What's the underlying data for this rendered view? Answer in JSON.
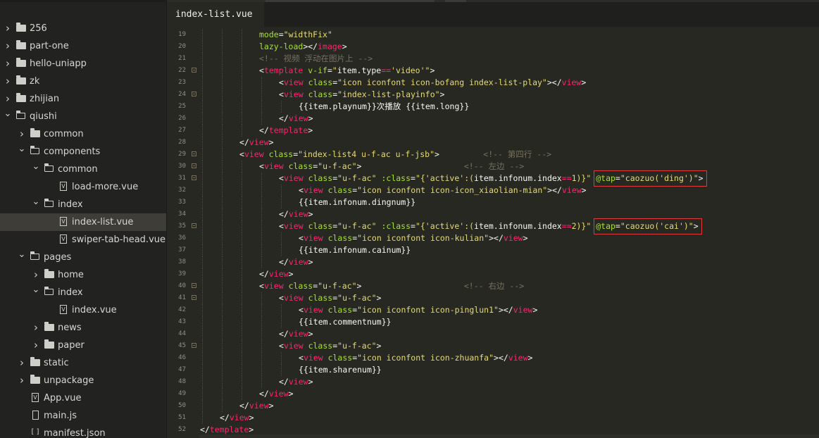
{
  "tab": {
    "title": "index-list.vue"
  },
  "tree": [
    {
      "name": "256",
      "type": "folder",
      "depth": 0,
      "expanded": false
    },
    {
      "name": "part-one",
      "type": "folder",
      "depth": 0,
      "expanded": false
    },
    {
      "name": "hello-uniapp",
      "type": "folder",
      "depth": 0,
      "expanded": false
    },
    {
      "name": "zk",
      "type": "folder",
      "depth": 0,
      "expanded": false
    },
    {
      "name": "zhijian",
      "type": "folder",
      "depth": 0,
      "expanded": false
    },
    {
      "name": "qiushi",
      "type": "folder",
      "depth": 0,
      "expanded": true
    },
    {
      "name": "common",
      "type": "folder",
      "depth": 1,
      "expanded": false
    },
    {
      "name": "components",
      "type": "folder",
      "depth": 1,
      "expanded": true
    },
    {
      "name": "common",
      "type": "folder",
      "depth": 2,
      "expanded": true
    },
    {
      "name": "load-more.vue",
      "type": "vue",
      "depth": 3
    },
    {
      "name": "index",
      "type": "folder",
      "depth": 2,
      "expanded": true
    },
    {
      "name": "index-list.vue",
      "type": "vue",
      "depth": 3,
      "selected": true
    },
    {
      "name": "swiper-tab-head.vue",
      "type": "vue",
      "depth": 3
    },
    {
      "name": "pages",
      "type": "folder",
      "depth": 1,
      "expanded": true
    },
    {
      "name": "home",
      "type": "folder",
      "depth": 2,
      "expanded": false
    },
    {
      "name": "index",
      "type": "folder",
      "depth": 2,
      "expanded": true
    },
    {
      "name": "index.vue",
      "type": "vue",
      "depth": 3
    },
    {
      "name": "news",
      "type": "folder",
      "depth": 2,
      "expanded": false
    },
    {
      "name": "paper",
      "type": "folder",
      "depth": 2,
      "expanded": false
    },
    {
      "name": "static",
      "type": "folder",
      "depth": 1,
      "expanded": false
    },
    {
      "name": "unpackage",
      "type": "folder",
      "depth": 1,
      "expanded": false
    },
    {
      "name": "App.vue",
      "type": "vue",
      "depth": 1
    },
    {
      "name": "main.js",
      "type": "js",
      "depth": 1
    },
    {
      "name": "manifest.json",
      "type": "json",
      "depth": 1
    }
  ],
  "code": [
    {
      "n": "19",
      "indent": 3,
      "fold": false,
      "tokens": [
        [
          "attr",
          "mode"
        ],
        [
          "pun",
          "="
        ],
        [
          "str",
          "\"widthFix\""
        ]
      ]
    },
    {
      "n": "20",
      "indent": 3,
      "fold": false,
      "tokens": [
        [
          "attr",
          "lazy-load"
        ],
        [
          "pun",
          ">"
        ],
        [
          "pun",
          "</"
        ],
        [
          "tag",
          "image"
        ],
        [
          "pun",
          ">"
        ]
      ]
    },
    {
      "n": "21",
      "indent": 3,
      "fold": false,
      "tokens": [
        [
          "com",
          "<!-- 视频 浮动在图片上 -->"
        ]
      ]
    },
    {
      "n": "22",
      "indent": 3,
      "fold": true,
      "tokens": [
        [
          "pun",
          "<"
        ],
        [
          "tag",
          "template"
        ],
        [
          "pun",
          " "
        ],
        [
          "attr",
          "v-if"
        ],
        [
          "pun",
          "="
        ],
        [
          "str",
          "\""
        ],
        [
          "expr",
          "item"
        ],
        [
          "pun",
          "."
        ],
        [
          "expr",
          "type"
        ],
        [
          "op",
          "=="
        ],
        [
          "str",
          "'video'\""
        ],
        [
          "pun",
          ">"
        ]
      ]
    },
    {
      "n": "23",
      "indent": 4,
      "fold": false,
      "tokens": [
        [
          "pun",
          "<"
        ],
        [
          "tag",
          "view"
        ],
        [
          "pun",
          " "
        ],
        [
          "attr",
          "class"
        ],
        [
          "pun",
          "="
        ],
        [
          "str",
          "\"icon iconfont icon-bofang index-list-play\""
        ],
        [
          "pun",
          ">"
        ],
        [
          "pun",
          "</"
        ],
        [
          "tag",
          "view"
        ],
        [
          "pun",
          ">"
        ]
      ]
    },
    {
      "n": "24",
      "indent": 4,
      "fold": true,
      "tokens": [
        [
          "pun",
          "<"
        ],
        [
          "tag",
          "view"
        ],
        [
          "pun",
          " "
        ],
        [
          "attr",
          "class"
        ],
        [
          "pun",
          "="
        ],
        [
          "str",
          "\"index-list-playinfo\""
        ],
        [
          "pun",
          ">"
        ]
      ]
    },
    {
      "n": "25",
      "indent": 5,
      "fold": false,
      "tokens": [
        [
          "expr",
          "{{item"
        ],
        [
          "pun",
          "."
        ],
        [
          "expr",
          "playnum}}次播放 {{item"
        ],
        [
          "pun",
          "."
        ],
        [
          "expr",
          "long}}"
        ]
      ]
    },
    {
      "n": "26",
      "indent": 4,
      "fold": false,
      "tokens": [
        [
          "pun",
          "</"
        ],
        [
          "tag",
          "view"
        ],
        [
          "pun",
          ">"
        ]
      ]
    },
    {
      "n": "27",
      "indent": 3,
      "fold": false,
      "tokens": [
        [
          "pun",
          "</"
        ],
        [
          "tag",
          "template"
        ],
        [
          "pun",
          ">"
        ]
      ]
    },
    {
      "n": "28",
      "indent": 2,
      "fold": false,
      "tokens": [
        [
          "pun",
          "</"
        ],
        [
          "tag",
          "view"
        ],
        [
          "pun",
          ">"
        ]
      ]
    },
    {
      "n": "29",
      "indent": 2,
      "fold": true,
      "tokens": [
        [
          "pun",
          "<"
        ],
        [
          "tag",
          "view"
        ],
        [
          "pun",
          " "
        ],
        [
          "attr",
          "class"
        ],
        [
          "pun",
          "="
        ],
        [
          "str",
          "\"index-list4 u-f-ac u-f-jsb\""
        ],
        [
          "pun",
          ">"
        ],
        [
          "pun",
          "         "
        ],
        [
          "com",
          "<!-- 第四行 -->"
        ]
      ]
    },
    {
      "n": "30",
      "indent": 3,
      "fold": true,
      "tokens": [
        [
          "pun",
          "<"
        ],
        [
          "tag",
          "view"
        ],
        [
          "pun",
          " "
        ],
        [
          "attr",
          "class"
        ],
        [
          "pun",
          "="
        ],
        [
          "str",
          "\"u-f-ac\""
        ],
        [
          "pun",
          ">"
        ],
        [
          "pun",
          "                     "
        ],
        [
          "com",
          "<!-- 左边 -->"
        ]
      ]
    },
    {
      "n": "31",
      "indent": 4,
      "fold": true,
      "tokens": [
        [
          "pun",
          "<"
        ],
        [
          "tag",
          "view"
        ],
        [
          "pun",
          " "
        ],
        [
          "attr",
          "class"
        ],
        [
          "pun",
          "="
        ],
        [
          "str",
          "\"u-f-ac\""
        ],
        [
          "pun",
          " "
        ],
        [
          "attr",
          ":class"
        ],
        [
          "pun",
          "="
        ],
        [
          "str",
          "\"{'active':("
        ],
        [
          "expr",
          "item"
        ],
        [
          "pun",
          "."
        ],
        [
          "expr",
          "infonum"
        ],
        [
          "pun",
          "."
        ],
        [
          "expr",
          "index"
        ],
        [
          "op",
          "=="
        ],
        [
          "str",
          "1)}\""
        ],
        [
          "pun",
          " "
        ],
        [
          "attr",
          "@tap"
        ],
        [
          "pun",
          "="
        ],
        [
          "str",
          "\"caozuo('ding')\""
        ],
        [
          "pun",
          ">"
        ]
      ]
    },
    {
      "n": "32",
      "indent": 5,
      "fold": false,
      "tokens": [
        [
          "pun",
          "<"
        ],
        [
          "tag",
          "view"
        ],
        [
          "pun",
          " "
        ],
        [
          "attr",
          "class"
        ],
        [
          "pun",
          "="
        ],
        [
          "str",
          "\"icon iconfont icon-icon_xiaolian-mian\""
        ],
        [
          "pun",
          ">"
        ],
        [
          "pun",
          "</"
        ],
        [
          "tag",
          "view"
        ],
        [
          "pun",
          ">"
        ]
      ]
    },
    {
      "n": "33",
      "indent": 5,
      "fold": false,
      "tokens": [
        [
          "expr",
          "{{item"
        ],
        [
          "pun",
          "."
        ],
        [
          "expr",
          "infonum"
        ],
        [
          "pun",
          "."
        ],
        [
          "expr",
          "dingnum}}"
        ]
      ]
    },
    {
      "n": "34",
      "indent": 4,
      "fold": false,
      "tokens": [
        [
          "pun",
          "</"
        ],
        [
          "tag",
          "view"
        ],
        [
          "pun",
          ">"
        ]
      ]
    },
    {
      "n": "35",
      "indent": 4,
      "fold": true,
      "tokens": [
        [
          "pun",
          "<"
        ],
        [
          "tag",
          "view"
        ],
        [
          "pun",
          " "
        ],
        [
          "attr",
          "class"
        ],
        [
          "pun",
          "="
        ],
        [
          "str",
          "\"u-f-ac\""
        ],
        [
          "pun",
          " "
        ],
        [
          "attr",
          ":class"
        ],
        [
          "pun",
          "="
        ],
        [
          "str",
          "\"{'active':("
        ],
        [
          "expr",
          "item"
        ],
        [
          "pun",
          "."
        ],
        [
          "expr",
          "infonum"
        ],
        [
          "pun",
          "."
        ],
        [
          "expr",
          "index"
        ],
        [
          "op",
          "=="
        ],
        [
          "str",
          "2)}\""
        ],
        [
          "pun",
          " "
        ],
        [
          "attr",
          "@tap"
        ],
        [
          "pun",
          "="
        ],
        [
          "str",
          "\"caozuo('cai')\""
        ],
        [
          "pun",
          ">"
        ]
      ]
    },
    {
      "n": "36",
      "indent": 5,
      "fold": false,
      "tokens": [
        [
          "pun",
          "<"
        ],
        [
          "tag",
          "view"
        ],
        [
          "pun",
          " "
        ],
        [
          "attr",
          "class"
        ],
        [
          "pun",
          "="
        ],
        [
          "str",
          "\"icon iconfont icon-kulian\""
        ],
        [
          "pun",
          ">"
        ],
        [
          "pun",
          "</"
        ],
        [
          "tag",
          "view"
        ],
        [
          "pun",
          ">"
        ]
      ]
    },
    {
      "n": "37",
      "indent": 5,
      "fold": false,
      "tokens": [
        [
          "expr",
          "{{item"
        ],
        [
          "pun",
          "."
        ],
        [
          "expr",
          "infonum"
        ],
        [
          "pun",
          "."
        ],
        [
          "expr",
          "cainum}}"
        ]
      ]
    },
    {
      "n": "38",
      "indent": 4,
      "fold": false,
      "tokens": [
        [
          "pun",
          "</"
        ],
        [
          "tag",
          "view"
        ],
        [
          "pun",
          ">"
        ]
      ]
    },
    {
      "n": "39",
      "indent": 3,
      "fold": false,
      "tokens": [
        [
          "pun",
          "</"
        ],
        [
          "tag",
          "view"
        ],
        [
          "pun",
          ">"
        ]
      ]
    },
    {
      "n": "40",
      "indent": 3,
      "fold": true,
      "tokens": [
        [
          "pun",
          "<"
        ],
        [
          "tag",
          "view"
        ],
        [
          "pun",
          " "
        ],
        [
          "attr",
          "class"
        ],
        [
          "pun",
          "="
        ],
        [
          "str",
          "\"u-f-ac\""
        ],
        [
          "pun",
          ">"
        ],
        [
          "pun",
          "                     "
        ],
        [
          "com",
          "<!-- 右边 -->"
        ]
      ]
    },
    {
      "n": "41",
      "indent": 4,
      "fold": true,
      "tokens": [
        [
          "pun",
          "<"
        ],
        [
          "tag",
          "view"
        ],
        [
          "pun",
          " "
        ],
        [
          "attr",
          "class"
        ],
        [
          "pun",
          "="
        ],
        [
          "str",
          "\"u-f-ac\""
        ],
        [
          "pun",
          ">"
        ]
      ]
    },
    {
      "n": "42",
      "indent": 5,
      "fold": false,
      "tokens": [
        [
          "pun",
          "<"
        ],
        [
          "tag",
          "view"
        ],
        [
          "pun",
          " "
        ],
        [
          "attr",
          "class"
        ],
        [
          "pun",
          "="
        ],
        [
          "str",
          "\"icon iconfont icon-pinglun1\""
        ],
        [
          "pun",
          ">"
        ],
        [
          "pun",
          "</"
        ],
        [
          "tag",
          "view"
        ],
        [
          "pun",
          ">"
        ]
      ]
    },
    {
      "n": "43",
      "indent": 5,
      "fold": false,
      "tokens": [
        [
          "expr",
          "{{item"
        ],
        [
          "pun",
          "."
        ],
        [
          "expr",
          "commentnum}}"
        ]
      ]
    },
    {
      "n": "44",
      "indent": 4,
      "fold": false,
      "tokens": [
        [
          "pun",
          "</"
        ],
        [
          "tag",
          "view"
        ],
        [
          "pun",
          ">"
        ]
      ]
    },
    {
      "n": "45",
      "indent": 4,
      "fold": true,
      "tokens": [
        [
          "pun",
          "<"
        ],
        [
          "tag",
          "view"
        ],
        [
          "pun",
          " "
        ],
        [
          "attr",
          "class"
        ],
        [
          "pun",
          "="
        ],
        [
          "str",
          "\"u-f-ac\""
        ],
        [
          "pun",
          ">"
        ]
      ]
    },
    {
      "n": "46",
      "indent": 5,
      "fold": false,
      "tokens": [
        [
          "pun",
          "<"
        ],
        [
          "tag",
          "view"
        ],
        [
          "pun",
          " "
        ],
        [
          "attr",
          "class"
        ],
        [
          "pun",
          "="
        ],
        [
          "str",
          "\"icon iconfont icon-zhuanfa\""
        ],
        [
          "pun",
          ">"
        ],
        [
          "pun",
          "</"
        ],
        [
          "tag",
          "view"
        ],
        [
          "pun",
          ">"
        ]
      ]
    },
    {
      "n": "47",
      "indent": 5,
      "fold": false,
      "tokens": [
        [
          "expr",
          "{{item"
        ],
        [
          "pun",
          "."
        ],
        [
          "expr",
          "sharenum}}"
        ]
      ]
    },
    {
      "n": "48",
      "indent": 4,
      "fold": false,
      "tokens": [
        [
          "pun",
          "</"
        ],
        [
          "tag",
          "view"
        ],
        [
          "pun",
          ">"
        ]
      ]
    },
    {
      "n": "49",
      "indent": 3,
      "fold": false,
      "tokens": [
        [
          "pun",
          "</"
        ],
        [
          "tag",
          "view"
        ],
        [
          "pun",
          ">"
        ]
      ]
    },
    {
      "n": "50",
      "indent": 2,
      "fold": false,
      "tokens": [
        [
          "pun",
          "</"
        ],
        [
          "tag",
          "view"
        ],
        [
          "pun",
          ">"
        ]
      ]
    },
    {
      "n": "51",
      "indent": 1,
      "fold": false,
      "tokens": [
        [
          "pun",
          "</"
        ],
        [
          "tag",
          "view"
        ],
        [
          "pun",
          ">"
        ]
      ]
    },
    {
      "n": "52",
      "indent": 0,
      "fold": false,
      "tokens": [
        [
          "pun",
          "</"
        ],
        [
          "tag",
          "template"
        ],
        [
          "pun",
          ">"
        ]
      ]
    }
  ],
  "highlights": [
    {
      "line": "31",
      "text": "@tap=\"caozuo('ding')\">"
    },
    {
      "line": "35",
      "text": "@tap=\"caozuo('cai')\">"
    }
  ],
  "colors": {
    "background": "#272822",
    "sidebar": "#222220",
    "tag": "#f92672",
    "attribute": "#a6e22e",
    "string": "#e6db74",
    "comment": "#75715e",
    "highlight_box": "#e03a3a"
  }
}
